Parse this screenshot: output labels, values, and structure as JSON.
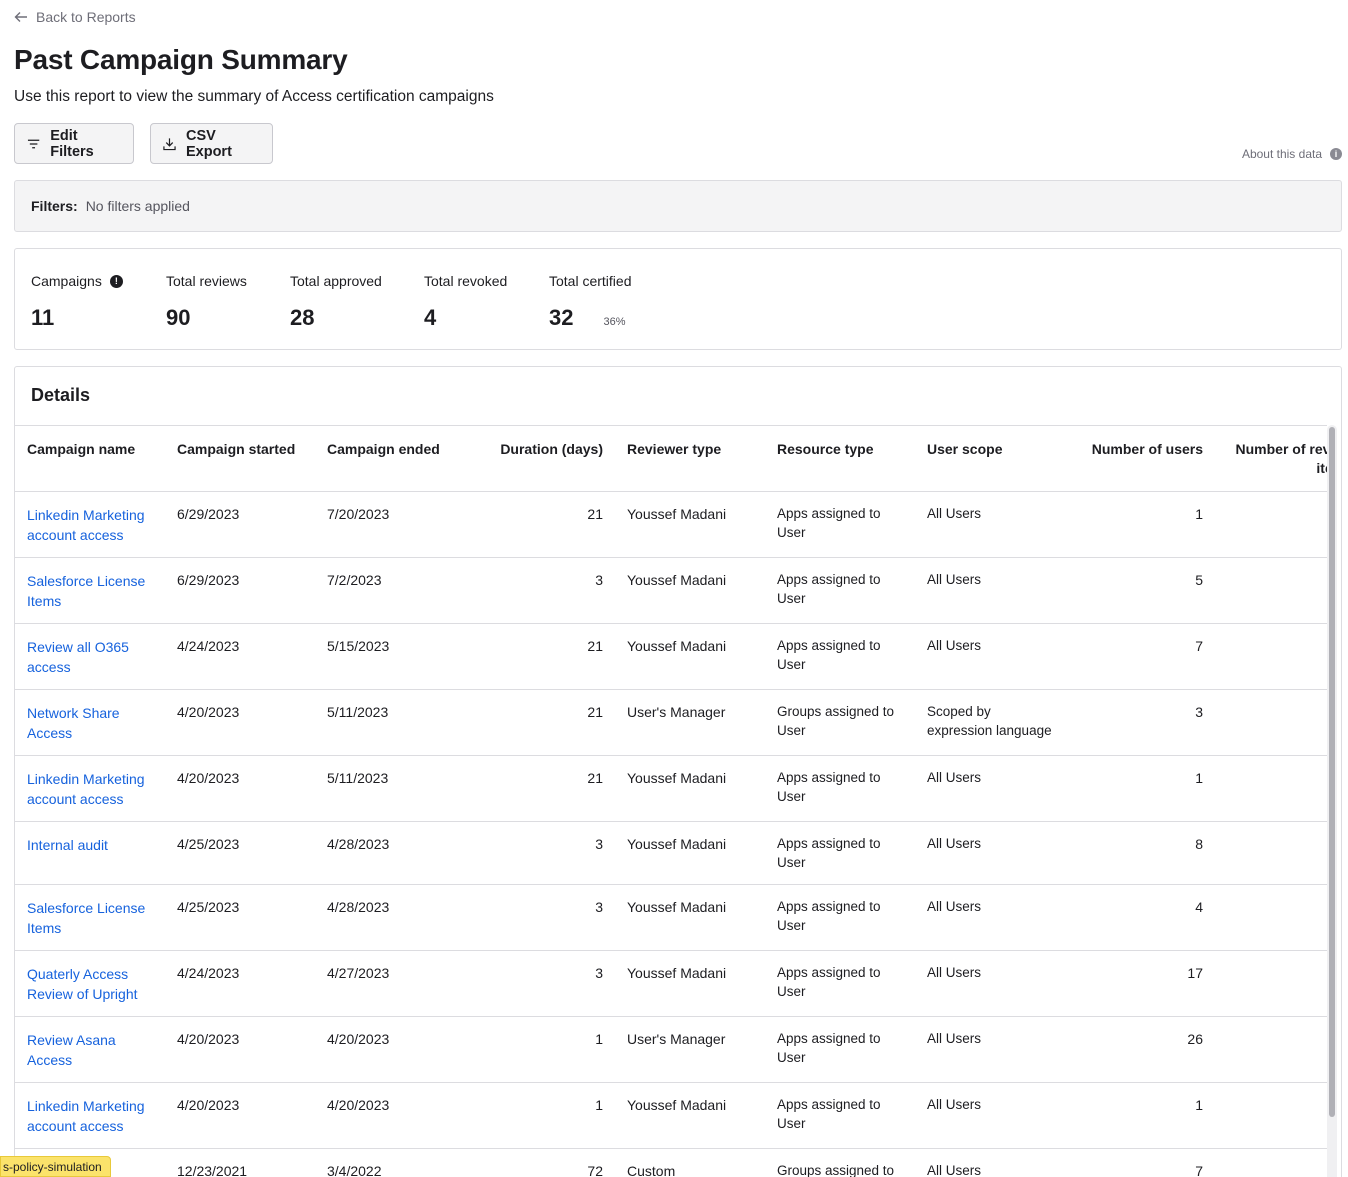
{
  "nav": {
    "back_label": "Back to Reports"
  },
  "header": {
    "title": "Past Campaign Summary",
    "subtitle": "Use this report to view the summary of Access certification campaigns"
  },
  "toolbar": {
    "edit_filters_label": "Edit Filters",
    "csv_export_label": "CSV Export",
    "about_label": "About this data"
  },
  "filters": {
    "label": "Filters:",
    "value": "No filters applied"
  },
  "stats": {
    "campaigns": {
      "label": "Campaigns",
      "value": "11"
    },
    "total_reviews": {
      "label": "Total reviews",
      "value": "90"
    },
    "total_approved": {
      "label": "Total approved",
      "value": "28"
    },
    "total_revoked": {
      "label": "Total revoked",
      "value": "4"
    },
    "total_certified": {
      "label": "Total certified",
      "value": "32",
      "percent": "36%"
    }
  },
  "details": {
    "title": "Details",
    "columns": [
      "Campaign name",
      "Campaign started",
      "Campaign ended",
      "Duration (days)",
      "Reviewer type",
      "Resource type",
      "User scope",
      "Number of users",
      "Number of review items"
    ],
    "rows": [
      [
        "Linkedin Marketing account access",
        "6/29/2023",
        "7/20/2023",
        "21",
        "Youssef Madani",
        "Apps assigned to User",
        "All Users",
        "1"
      ],
      [
        "Salesforce License Items",
        "6/29/2023",
        "7/2/2023",
        "3",
        "Youssef Madani",
        "Apps assigned to User",
        "All Users",
        "5"
      ],
      [
        "Review all O365 access",
        "4/24/2023",
        "5/15/2023",
        "21",
        "Youssef Madani",
        "Apps assigned to User",
        "All Users",
        "7"
      ],
      [
        "Network Share Access",
        "4/20/2023",
        "5/11/2023",
        "21",
        "User's Manager",
        "Groups assigned to User",
        "Scoped by expression language",
        "3"
      ],
      [
        "Linkedin Marketing account access",
        "4/20/2023",
        "5/11/2023",
        "21",
        "Youssef Madani",
        "Apps assigned to User",
        "All Users",
        "1"
      ],
      [
        "Internal audit",
        "4/25/2023",
        "4/28/2023",
        "3",
        "Youssef Madani",
        "Apps assigned to User",
        "All Users",
        "8"
      ],
      [
        "Salesforce License Items",
        "4/25/2023",
        "4/28/2023",
        "3",
        "Youssef Madani",
        "Apps assigned to User",
        "All Users",
        "4"
      ],
      [
        "Quaterly Access Review of Upright",
        "4/24/2023",
        "4/27/2023",
        "3",
        "Youssef Madani",
        "Apps assigned to User",
        "All Users",
        "17"
      ],
      [
        "Review Asana Access",
        "4/20/2023",
        "4/20/2023",
        "1",
        "User's Manager",
        "Apps assigned to User",
        "All Users",
        "26"
      ],
      [
        "Linkedin Marketing account access",
        "4/20/2023",
        "4/20/2023",
        "1",
        "Youssef Madani",
        "Apps assigned to User",
        "All Users",
        "1"
      ],
      [
        "",
        "12/23/2021",
        "3/4/2022",
        "72",
        "Custom",
        "Groups assigned to User",
        "All Users",
        "7"
      ]
    ]
  },
  "env_badge": "s-policy-simulation"
}
